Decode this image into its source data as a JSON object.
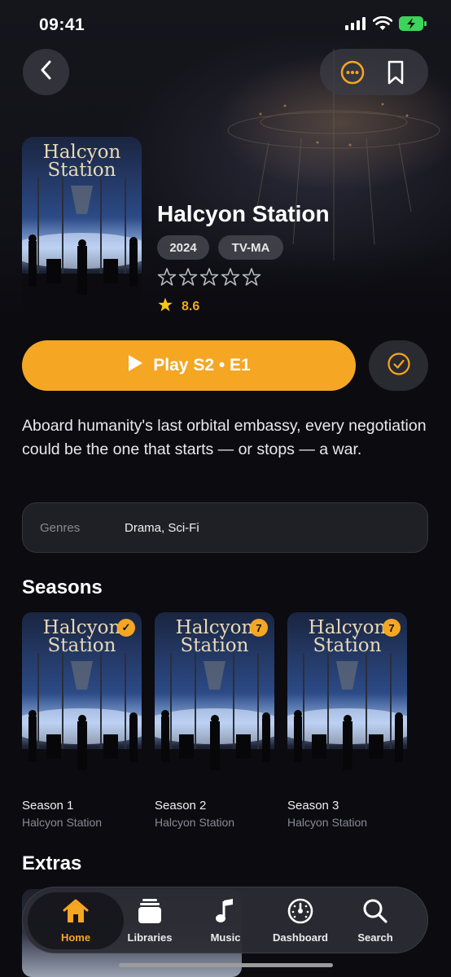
{
  "status": {
    "time": "09:41"
  },
  "header": {
    "back_icon": "chevron-left-icon",
    "more_icon": "more-icon",
    "bookmark_icon": "bookmark-icon"
  },
  "show": {
    "poster_title_line1": "Halcyon",
    "poster_title_line2": "Station",
    "title": "Halcyon Station",
    "year": "2024",
    "content_rating": "TV-MA",
    "user_rating_stars": 0,
    "community_rating": "8.6",
    "play_label": "Play S2 • E1",
    "description": "Aboard humanity's last orbital embassy, every negotiation could be the one that starts — or stops — a war.",
    "genres_label": "Genres",
    "genres_value": "Drama, Sci-Fi"
  },
  "colors": {
    "accent": "#f5a623",
    "background": "#0b0b10"
  },
  "seasons_title": "Seasons",
  "seasons": [
    {
      "name": "Season 1",
      "series": "Halcyon Station",
      "badge": "✓"
    },
    {
      "name": "Season 2",
      "series": "Halcyon Station",
      "badge": "7"
    },
    {
      "name": "Season 3",
      "series": "Halcyon Station",
      "badge": "7"
    }
  ],
  "extras_title": "Extras",
  "tabs": [
    {
      "label": "Home",
      "icon": "home-icon",
      "active": true
    },
    {
      "label": "Libraries",
      "icon": "libraries-icon",
      "active": false
    },
    {
      "label": "Music",
      "icon": "music-icon",
      "active": false
    },
    {
      "label": "Dashboard",
      "icon": "dashboard-icon",
      "active": false
    },
    {
      "label": "Search",
      "icon": "search-icon",
      "active": false
    }
  ]
}
